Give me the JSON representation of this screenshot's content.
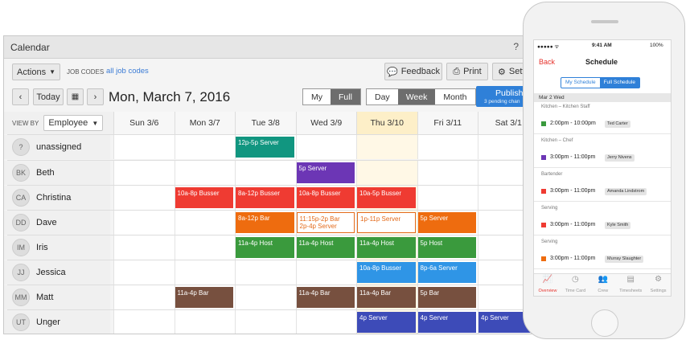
{
  "app": {
    "window_title": "Calendar",
    "help": "?",
    "actions_label": "Actions",
    "job_codes_label": "JOB CODES",
    "job_codes_link": "all job codes",
    "feedback_label": "Feedback",
    "print_label": "Print",
    "settings_label": "Setti",
    "today_label": "Today",
    "date_title": "Mon, March 7, 2016",
    "scope": [
      "My",
      "Full"
    ],
    "scope_selected": "Full",
    "range": [
      "Day",
      "Week",
      "Month"
    ],
    "range_selected": "Week",
    "publish_label": "Publish",
    "publish_sub": "3 pending chan",
    "view_by_label": "VIEW BY",
    "view_by_value": "Employee"
  },
  "days": [
    "Sun 3/6",
    "Mon 3/7",
    "Tue 3/8",
    "Wed 3/9",
    "Thu 3/10",
    "Fri 3/11",
    "Sat 3/1"
  ],
  "today_index": 4,
  "colors": {
    "teal": "#119680",
    "purple": "#6c36b5",
    "red": "#ef3b32",
    "orange": "#ee6c0f",
    "green": "#3a9a3d",
    "blue": "#2f95e6",
    "brown": "#77503f",
    "indigo": "#3d4bb8"
  },
  "employees": [
    {
      "initials": "?",
      "name": "unassigned",
      "shifts": [
        {
          "day": 2,
          "label": "12p-5p Server",
          "color": "teal"
        }
      ]
    },
    {
      "initials": "BK",
      "name": "Beth",
      "shifts": [
        {
          "day": 3,
          "label": "5p Server",
          "color": "purple"
        }
      ]
    },
    {
      "initials": "CA",
      "name": "Christina",
      "shifts": [
        {
          "day": 1,
          "label": "10a-8p Busser",
          "color": "red"
        },
        {
          "day": 2,
          "label": "8a-12p Busser",
          "color": "red"
        },
        {
          "day": 3,
          "label": "10a-8p Busser",
          "color": "red"
        },
        {
          "day": 4,
          "label": "10a-5p Busser",
          "color": "red"
        }
      ]
    },
    {
      "initials": "DD",
      "name": "Dave",
      "shifts": [
        {
          "day": 2,
          "label": "8a-12p Bar",
          "color": "orange"
        },
        {
          "day": 3,
          "label": "11:15p-2p Bar\n2p-4p Server",
          "color": "outline"
        },
        {
          "day": 4,
          "label": "1p-11p Server",
          "color": "outline"
        },
        {
          "day": 5,
          "label": "5p Server",
          "color": "orange"
        }
      ]
    },
    {
      "initials": "IM",
      "name": "Iris",
      "shifts": [
        {
          "day": 2,
          "label": "11a-4p Host",
          "color": "green"
        },
        {
          "day": 3,
          "label": "11a-4p Host",
          "color": "green"
        },
        {
          "day": 4,
          "label": "11a-4p Host",
          "color": "green"
        },
        {
          "day": 5,
          "label": "5p Host",
          "color": "green"
        }
      ]
    },
    {
      "initials": "JJ",
      "name": "Jessica",
      "shifts": [
        {
          "day": 4,
          "label": "10a-8p Busser",
          "color": "blue"
        },
        {
          "day": 5,
          "label": "8p-6a Server",
          "color": "blue"
        }
      ]
    },
    {
      "initials": "MM",
      "name": "Matt",
      "shifts": [
        {
          "day": 1,
          "label": "11a-4p Bar",
          "color": "brown"
        },
        {
          "day": 3,
          "label": "11a-4p Bar",
          "color": "brown"
        },
        {
          "day": 4,
          "label": "11a-4p Bar",
          "color": "brown"
        },
        {
          "day": 5,
          "label": "5p Bar",
          "color": "brown"
        }
      ]
    },
    {
      "initials": "UT",
      "name": "Unger",
      "shifts": [
        {
          "day": 4,
          "label": "4p Server",
          "color": "indigo"
        },
        {
          "day": 5,
          "label": "4p Server",
          "color": "indigo"
        },
        {
          "day": 6,
          "label": "4p Server",
          "color": "indigo"
        }
      ]
    }
  ],
  "phone": {
    "time": "9:41 AM",
    "battery": "100%",
    "back": "Back",
    "title": "Schedule",
    "tabs": [
      "My Schedule",
      "Full Schedule"
    ],
    "tab_selected": "Full Schedule",
    "date_header": "Mar 2 Wed",
    "entries": [
      {
        "category": "Kitchen – Kitchen Staff",
        "time": "2:00pm - 10:00pm",
        "person": "Ted Carter",
        "color": "#3a9a3d"
      },
      {
        "category": "Kitchen – Chef",
        "time": "3:00pm - 11:00pm",
        "person": "Jerry Nivens",
        "color": "#6c36b5"
      },
      {
        "category": "Bartender",
        "time": "3:00pm - 11:00pm",
        "person": "Amanda Lindstrom",
        "color": "#ef3b32"
      },
      {
        "category": "Serving",
        "time": "3:00pm - 11:00pm",
        "person": "Kyle Smith",
        "color": "#ef3b32"
      },
      {
        "category": "Serving",
        "time": "3:00pm - 11:00pm",
        "person": "Murray Slaughter",
        "color": "#ee6c0f"
      }
    ],
    "bottom_tabs": [
      "Overview",
      "Time Card",
      "Crew",
      "Timesheets",
      "Settings"
    ]
  }
}
